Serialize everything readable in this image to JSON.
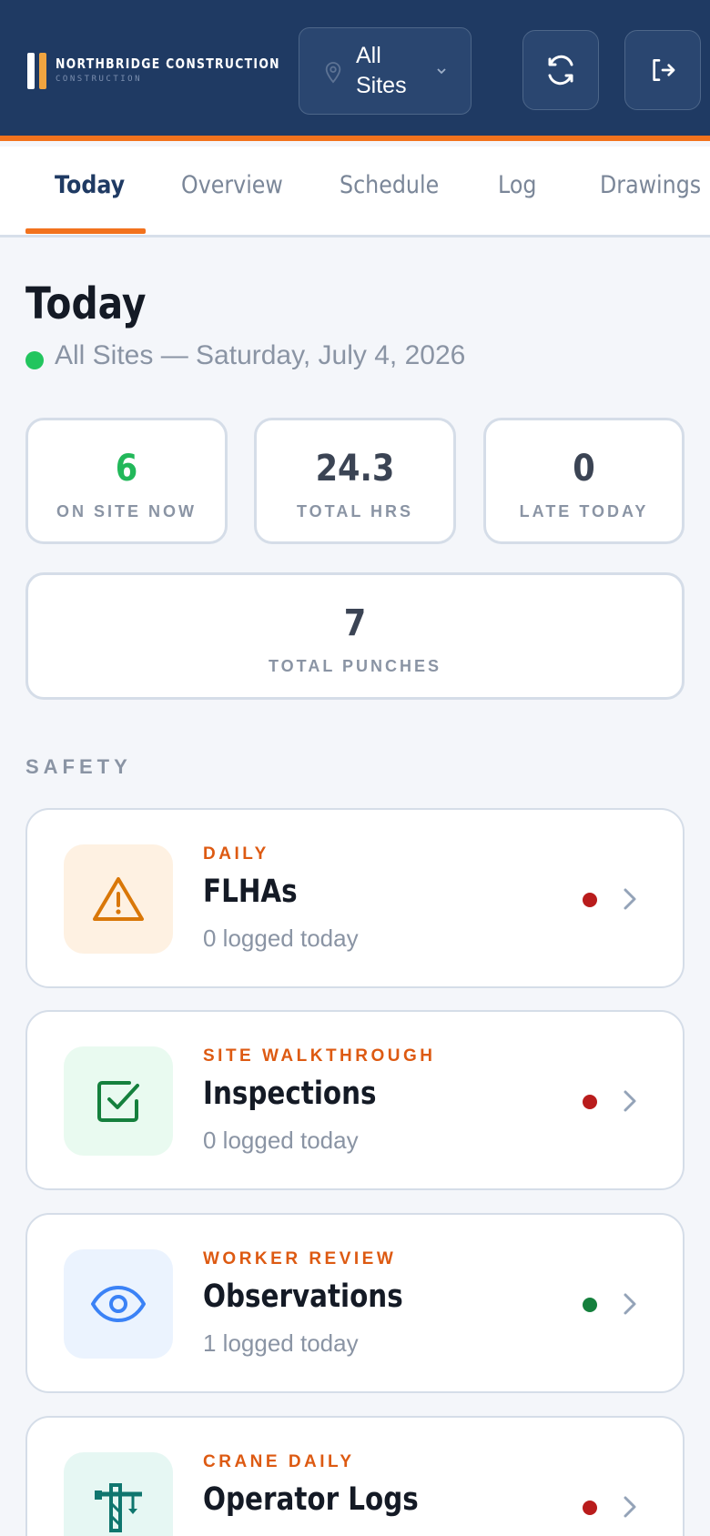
{
  "header": {
    "brand_name": "NORTHBRIDGE CONSTRUCTION",
    "brand_sub": "CONSTRUCTION",
    "site_selector": {
      "value": "All Sites",
      "icon": "map-pin-icon"
    },
    "refresh_icon": "refresh-icon",
    "logout_icon": "logout-icon"
  },
  "tabs": [
    {
      "label": "Today",
      "active": true
    },
    {
      "label": "Overview",
      "active": false
    },
    {
      "label": "Schedule",
      "active": false
    },
    {
      "label": "Log",
      "active": false
    },
    {
      "label": "Drawings",
      "active": false
    }
  ],
  "page": {
    "title": "Today",
    "subtitle": "All Sites — Saturday, July 4, 2026",
    "status_color": "#22c55e"
  },
  "stats": [
    {
      "value": "6",
      "label": "ON SITE NOW",
      "color": "#22b85a"
    },
    {
      "value": "24.3",
      "label": "TOTAL HRS"
    },
    {
      "value": "0",
      "label": "LATE TODAY"
    },
    {
      "value": "7",
      "label": "TOTAL PUNCHES"
    }
  ],
  "safety": {
    "label": "SAFETY",
    "items": [
      {
        "kicker": "DAILY",
        "title": "FLHAs",
        "meta": "0 logged today",
        "icon": "warning-icon",
        "status_color": "#b91c1c"
      },
      {
        "kicker": "SITE WALKTHROUGH",
        "title": "Inspections",
        "meta": "0 logged today",
        "icon": "checkbox-icon",
        "status_color": "#b91c1c"
      },
      {
        "kicker": "WORKER REVIEW",
        "title": "Observations",
        "meta": "1 logged today",
        "icon": "eye-icon",
        "status_color": "#15803d"
      },
      {
        "kicker": "CRANE DAILY",
        "title": "Operator Logs",
        "meta": "",
        "icon": "crane-icon",
        "status_color": "#b91c1c"
      }
    ]
  }
}
